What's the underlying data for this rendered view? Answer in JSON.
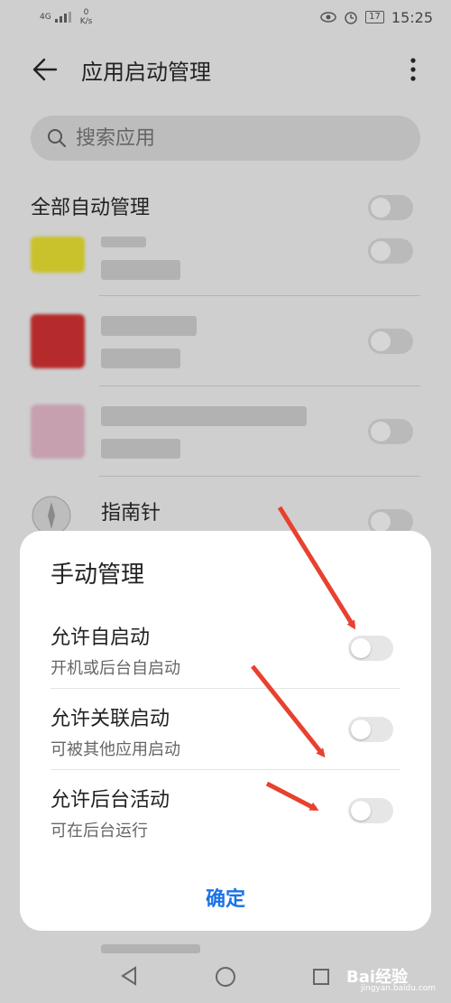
{
  "status_bar": {
    "network": "4G",
    "speed_value": "0",
    "speed_unit": "K/s",
    "battery": "17",
    "time": "15:25"
  },
  "header": {
    "title": "应用启动管理"
  },
  "search": {
    "placeholder": "搜索应用"
  },
  "list": {
    "all_manage_label": "全部自动管理",
    "visible_app_name": "指南针"
  },
  "dialog": {
    "title": "手动管理",
    "rows": [
      {
        "label": "允许自启动",
        "sub": "开机或后台自启动"
      },
      {
        "label": "允许关联启动",
        "sub": "可被其他应用启动"
      },
      {
        "label": "允许后台活动",
        "sub": "可在后台运行"
      }
    ],
    "confirm_label": "确定"
  },
  "watermark": {
    "text": "Bai经验",
    "sub": "jingyan.baidu.com"
  },
  "colors": {
    "accent": "#1a73e8",
    "arrow": "#e8412f"
  }
}
